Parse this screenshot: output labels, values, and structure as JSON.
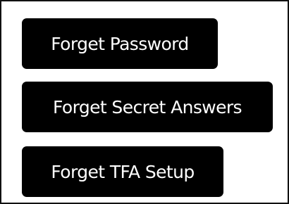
{
  "actions": {
    "forget_password_label": "Forget Password",
    "forget_secret_answers_label": "Forget Secret Answers",
    "forget_tfa_setup_label": "Forget TFA Setup"
  },
  "colors": {
    "button_background": "#000000",
    "button_text": "#ffffff",
    "page_background": "#ffffff",
    "border": "#111111"
  }
}
